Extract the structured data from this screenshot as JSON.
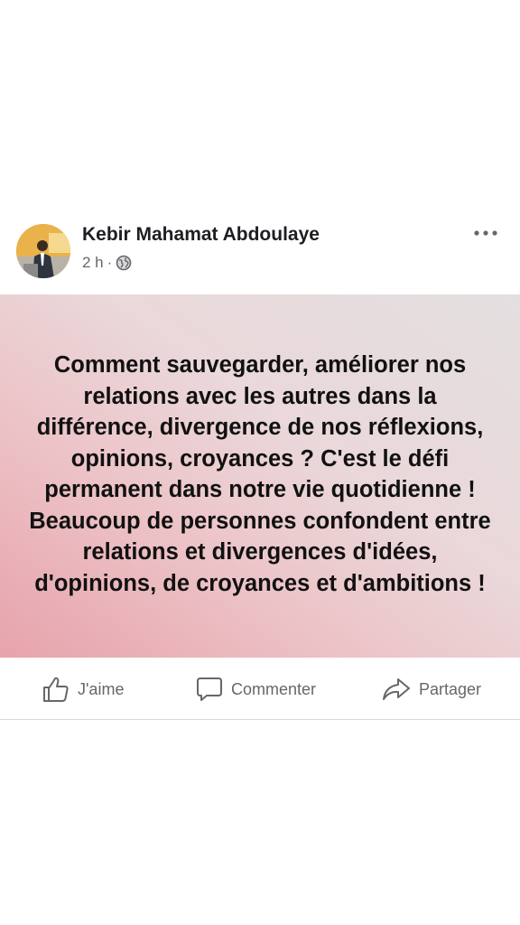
{
  "post": {
    "author": "Kebir Mahamat Abdoulaye",
    "time": "2 h",
    "separator": "·",
    "privacy_icon": "globe-icon",
    "menu_icon": "more-dots-icon",
    "text": "Comment sauvegarder, améliorer nos relations avec les autres dans la différence, divergence de nos réflexions, opinions, croyances ? C'est le défi permanent dans notre vie quotidienne ! Beaucoup de personnes confondent entre relations et divergences d'idées, d'opinions, de croyances et d'ambitions !",
    "background_colors": [
      "#e7a3ab",
      "#ecc4c8",
      "#ead8da",
      "#e3dfe0"
    ]
  },
  "actions": {
    "like_label": "J'aime",
    "like_icon": "thumbs-up-icon",
    "comment_label": "Commenter",
    "comment_icon": "comment-icon",
    "share_label": "Partager",
    "share_icon": "share-arrow-icon"
  },
  "colors": {
    "text_primary": "#1c1e21",
    "text_secondary": "#65676b",
    "divider": "#d8dadf"
  }
}
